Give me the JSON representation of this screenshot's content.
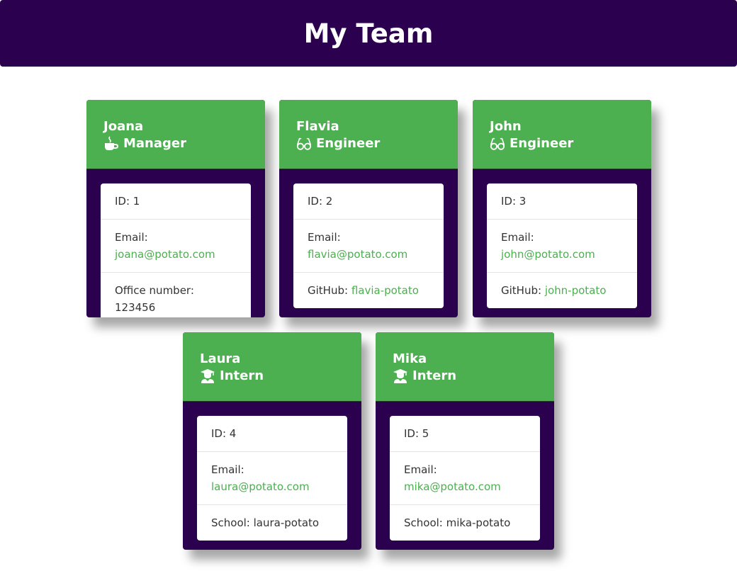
{
  "header": {
    "title": "My Team"
  },
  "colors": {
    "header_bg": "#2b004e",
    "card_head_bg": "#4caf50",
    "link": "#4caf50"
  },
  "employees": [
    {
      "name": "Joana",
      "role": "Manager",
      "role_icon": "coffee-icon",
      "id_text": "ID: 1",
      "email_label": "Email:",
      "email": "joana@potato.com",
      "extra_label": "Office number: ",
      "extra_value": "123456"
    },
    {
      "name": "Flavia",
      "role": "Engineer",
      "role_icon": "glasses-icon",
      "id_text": "ID: 2",
      "email_label": "Email:",
      "email": "flavia@potato.com",
      "extra_label": "GitHub: ",
      "extra_value": "flavia-potato"
    },
    {
      "name": "John",
      "role": "Engineer",
      "role_icon": "glasses-icon",
      "id_text": "ID: 3",
      "email_label": "Email:",
      "email": "john@potato.com",
      "extra_label": "GitHub: ",
      "extra_value": "john-potato"
    },
    {
      "name": "Laura",
      "role": "Intern",
      "role_icon": "graduate-icon",
      "id_text": "ID: 4",
      "email_label": "Email:",
      "email": "laura@potato.com",
      "extra_label": "School: ",
      "extra_value": "laura-potato"
    },
    {
      "name": "Mika",
      "role": "Intern",
      "role_icon": "graduate-icon",
      "id_text": "ID: 5",
      "email_label": "Email:",
      "email": "mika@potato.com",
      "extra_label": "School: ",
      "extra_value": "mika-potato"
    }
  ]
}
